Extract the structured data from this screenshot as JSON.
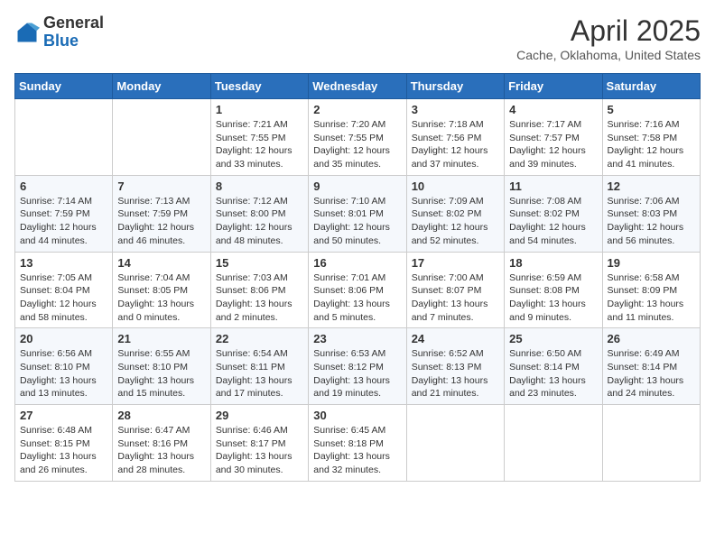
{
  "logo": {
    "general": "General",
    "blue": "Blue"
  },
  "header": {
    "title": "April 2025",
    "subtitle": "Cache, Oklahoma, United States"
  },
  "weekdays": [
    "Sunday",
    "Monday",
    "Tuesday",
    "Wednesday",
    "Thursday",
    "Friday",
    "Saturday"
  ],
  "weeks": [
    [
      {
        "day": "",
        "info": ""
      },
      {
        "day": "",
        "info": ""
      },
      {
        "day": "1",
        "info": "Sunrise: 7:21 AM\nSunset: 7:55 PM\nDaylight: 12 hours and 33 minutes."
      },
      {
        "day": "2",
        "info": "Sunrise: 7:20 AM\nSunset: 7:55 PM\nDaylight: 12 hours and 35 minutes."
      },
      {
        "day": "3",
        "info": "Sunrise: 7:18 AM\nSunset: 7:56 PM\nDaylight: 12 hours and 37 minutes."
      },
      {
        "day": "4",
        "info": "Sunrise: 7:17 AM\nSunset: 7:57 PM\nDaylight: 12 hours and 39 minutes."
      },
      {
        "day": "5",
        "info": "Sunrise: 7:16 AM\nSunset: 7:58 PM\nDaylight: 12 hours and 41 minutes."
      }
    ],
    [
      {
        "day": "6",
        "info": "Sunrise: 7:14 AM\nSunset: 7:59 PM\nDaylight: 12 hours and 44 minutes."
      },
      {
        "day": "7",
        "info": "Sunrise: 7:13 AM\nSunset: 7:59 PM\nDaylight: 12 hours and 46 minutes."
      },
      {
        "day": "8",
        "info": "Sunrise: 7:12 AM\nSunset: 8:00 PM\nDaylight: 12 hours and 48 minutes."
      },
      {
        "day": "9",
        "info": "Sunrise: 7:10 AM\nSunset: 8:01 PM\nDaylight: 12 hours and 50 minutes."
      },
      {
        "day": "10",
        "info": "Sunrise: 7:09 AM\nSunset: 8:02 PM\nDaylight: 12 hours and 52 minutes."
      },
      {
        "day": "11",
        "info": "Sunrise: 7:08 AM\nSunset: 8:02 PM\nDaylight: 12 hours and 54 minutes."
      },
      {
        "day": "12",
        "info": "Sunrise: 7:06 AM\nSunset: 8:03 PM\nDaylight: 12 hours and 56 minutes."
      }
    ],
    [
      {
        "day": "13",
        "info": "Sunrise: 7:05 AM\nSunset: 8:04 PM\nDaylight: 12 hours and 58 minutes."
      },
      {
        "day": "14",
        "info": "Sunrise: 7:04 AM\nSunset: 8:05 PM\nDaylight: 13 hours and 0 minutes."
      },
      {
        "day": "15",
        "info": "Sunrise: 7:03 AM\nSunset: 8:06 PM\nDaylight: 13 hours and 2 minutes."
      },
      {
        "day": "16",
        "info": "Sunrise: 7:01 AM\nSunset: 8:06 PM\nDaylight: 13 hours and 5 minutes."
      },
      {
        "day": "17",
        "info": "Sunrise: 7:00 AM\nSunset: 8:07 PM\nDaylight: 13 hours and 7 minutes."
      },
      {
        "day": "18",
        "info": "Sunrise: 6:59 AM\nSunset: 8:08 PM\nDaylight: 13 hours and 9 minutes."
      },
      {
        "day": "19",
        "info": "Sunrise: 6:58 AM\nSunset: 8:09 PM\nDaylight: 13 hours and 11 minutes."
      }
    ],
    [
      {
        "day": "20",
        "info": "Sunrise: 6:56 AM\nSunset: 8:10 PM\nDaylight: 13 hours and 13 minutes."
      },
      {
        "day": "21",
        "info": "Sunrise: 6:55 AM\nSunset: 8:10 PM\nDaylight: 13 hours and 15 minutes."
      },
      {
        "day": "22",
        "info": "Sunrise: 6:54 AM\nSunset: 8:11 PM\nDaylight: 13 hours and 17 minutes."
      },
      {
        "day": "23",
        "info": "Sunrise: 6:53 AM\nSunset: 8:12 PM\nDaylight: 13 hours and 19 minutes."
      },
      {
        "day": "24",
        "info": "Sunrise: 6:52 AM\nSunset: 8:13 PM\nDaylight: 13 hours and 21 minutes."
      },
      {
        "day": "25",
        "info": "Sunrise: 6:50 AM\nSunset: 8:14 PM\nDaylight: 13 hours and 23 minutes."
      },
      {
        "day": "26",
        "info": "Sunrise: 6:49 AM\nSunset: 8:14 PM\nDaylight: 13 hours and 24 minutes."
      }
    ],
    [
      {
        "day": "27",
        "info": "Sunrise: 6:48 AM\nSunset: 8:15 PM\nDaylight: 13 hours and 26 minutes."
      },
      {
        "day": "28",
        "info": "Sunrise: 6:47 AM\nSunset: 8:16 PM\nDaylight: 13 hours and 28 minutes."
      },
      {
        "day": "29",
        "info": "Sunrise: 6:46 AM\nSunset: 8:17 PM\nDaylight: 13 hours and 30 minutes."
      },
      {
        "day": "30",
        "info": "Sunrise: 6:45 AM\nSunset: 8:18 PM\nDaylight: 13 hours and 32 minutes."
      },
      {
        "day": "",
        "info": ""
      },
      {
        "day": "",
        "info": ""
      },
      {
        "day": "",
        "info": ""
      }
    ]
  ]
}
